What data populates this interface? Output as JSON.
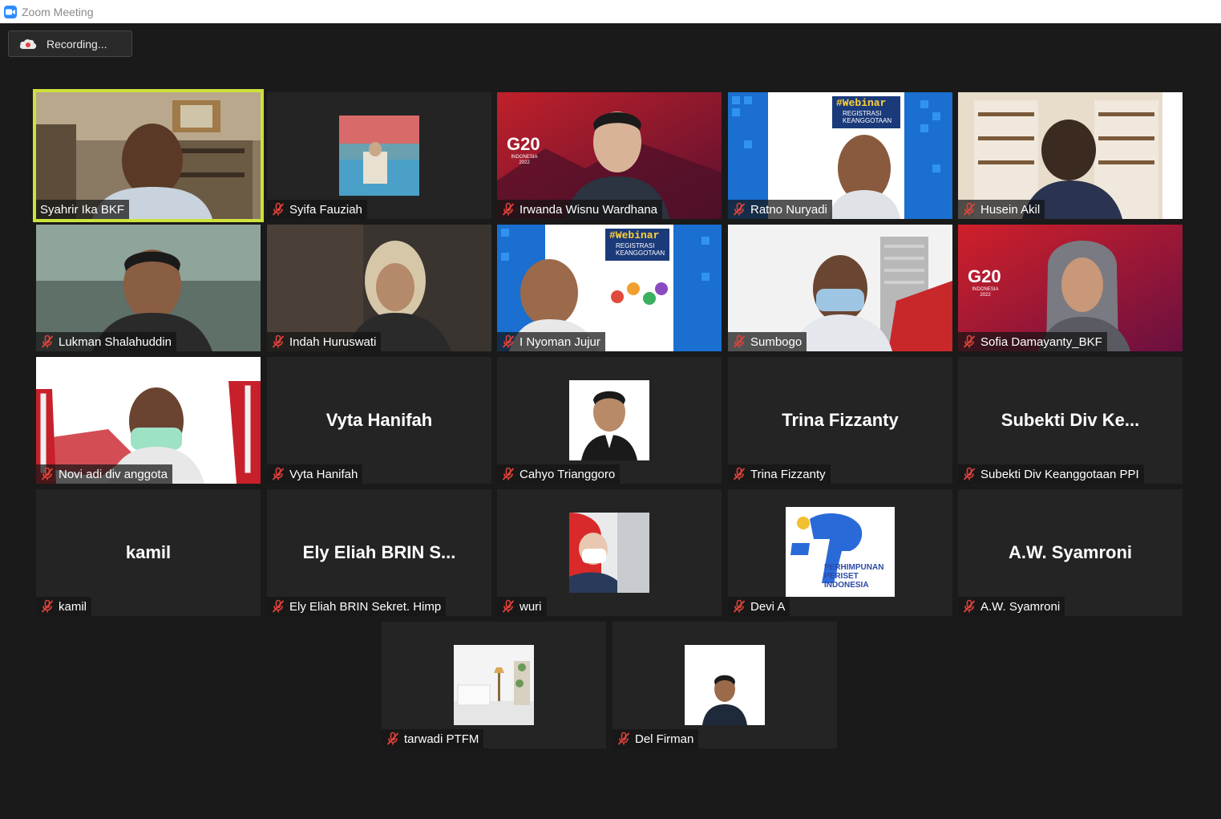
{
  "window": {
    "title": "Zoom Meeting"
  },
  "recording": {
    "label": "Recording..."
  },
  "colors": {
    "active_speaker": "#cde23a",
    "muted": "#e0423a",
    "zoom_blue": "#2d8cff"
  },
  "participants": [
    {
      "name": "Syahrir Ika BKF",
      "muted": false,
      "active": true,
      "kind": "video"
    },
    {
      "name": "Syifa Fauziah",
      "muted": true,
      "kind": "thumb"
    },
    {
      "name": "Irwanda Wisnu Wardhana",
      "muted": true,
      "kind": "video",
      "bg_text": "G20",
      "bg_sub": "INDONESIA 2022"
    },
    {
      "name": "Ratno Nuryadi",
      "muted": true,
      "kind": "video",
      "bg_text": "#Webinar",
      "bg_sub": "REGISTRASI KEANGGOTAAN"
    },
    {
      "name": "Husein Akil",
      "muted": true,
      "kind": "video"
    },
    {
      "name": "Lukman Shalahuddin",
      "muted": true,
      "kind": "video"
    },
    {
      "name": "Indah Huruswati",
      "muted": true,
      "kind": "video"
    },
    {
      "name": "I Nyoman Jujur",
      "muted": true,
      "kind": "video",
      "bg_text": "#Webinar",
      "bg_sub": "REGISTRASI KEANGGOTAAN"
    },
    {
      "name": "Sumbogo",
      "muted": true,
      "kind": "video"
    },
    {
      "name": "Sofia Damayanty_BKF",
      "muted": true,
      "kind": "video",
      "bg_text": "G20",
      "bg_sub": "INDONESIA 2022"
    },
    {
      "name": "Novi adi div anggota",
      "muted": true,
      "kind": "video"
    },
    {
      "name": "Vyta Hanifah",
      "muted": true,
      "kind": "name",
      "display": "Vyta Hanifah"
    },
    {
      "name": "Cahyo Trianggoro",
      "muted": true,
      "kind": "thumb"
    },
    {
      "name": "Trina Fizzanty",
      "muted": true,
      "kind": "name",
      "display": "Trina Fizzanty"
    },
    {
      "name": "Subekti  Div Keanggotaan PPI",
      "muted": true,
      "kind": "name",
      "display": "Subekti  Div Ke..."
    },
    {
      "name": "kamil",
      "muted": true,
      "kind": "name",
      "display": "kamil"
    },
    {
      "name": "Ely Eliah BRIN Sekret. Himp",
      "muted": true,
      "kind": "name",
      "display": "Ely  Eliah  BRIN  S..."
    },
    {
      "name": "wuri",
      "muted": true,
      "kind": "thumb"
    },
    {
      "name": "Devi A",
      "muted": true,
      "kind": "logo",
      "logo_text": "PERHIMPUNAN PERISET INDONESIA"
    },
    {
      "name": "A.W. Syamroni",
      "muted": true,
      "kind": "name",
      "display": "A.W. Syamroni"
    },
    {
      "name": "tarwadi PTFM",
      "muted": true,
      "kind": "thumb"
    },
    {
      "name": "Del Firman",
      "muted": true,
      "kind": "thumb"
    }
  ]
}
